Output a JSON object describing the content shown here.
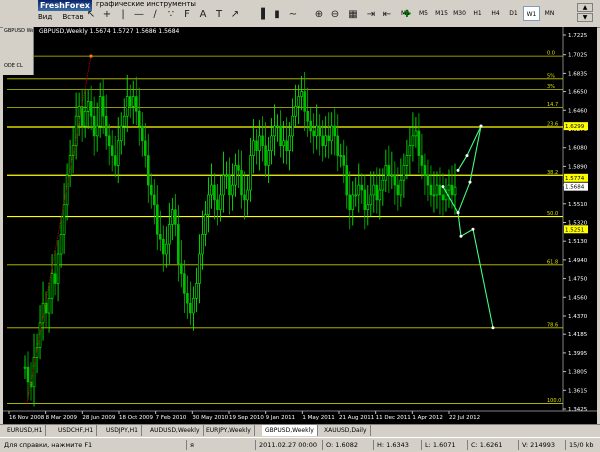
{
  "window": {
    "title": "FreshForex",
    "menu": [
      "Вид",
      "Встав"
    ],
    "toolbar_caption": "графические инструменты"
  },
  "chart_header": {
    "symbol_line": "GBPUSD,Weekly  1.5674 1.5727 1.5686 1.5684",
    "left_stub": "GBPUSD Weekly",
    "left_stub2": "ODE CL"
  },
  "timeframes": [
    "M1",
    "M5",
    "M15",
    "M30",
    "H1",
    "H4",
    "D1",
    "W1",
    "MN"
  ],
  "active_timeframe": "W1",
  "chart_data": {
    "type": "candlestick",
    "symbol": "GBPUSD",
    "timeframe": "Weekly",
    "ylim": [
      1.3425,
      1.7225
    ],
    "y_ticks": [
      "1.7225",
      "1.7025",
      "1.6835",
      "1.6650",
      "1.6460",
      "1.6270",
      "1.6080",
      "1.5890",
      "1.5700",
      "1.5510",
      "1.5320",
      "1.5130",
      "1.4940",
      "1.4750",
      "1.4560",
      "1.4370",
      "1.4185",
      "1.3995",
      "1.3805",
      "1.3615",
      "1.3425"
    ],
    "x_ticks": [
      "16 Nov 2008",
      "8 Mar 2009",
      "28 Jun 2009",
      "18 Oct 2009",
      "7 Feb 2010",
      "30 May 2010",
      "19 Sep 2010",
      "9 Jan 2011",
      "1 May 2011",
      "21 Aug 2011",
      "11 Dec 2011",
      "1 Apr 2012",
      "22 Jul 2012"
    ],
    "fibo_levels": [
      {
        "label": "0.0",
        "price": 1.701
      },
      {
        "label": "5%",
        "price": 1.678
      },
      {
        "label": "3%",
        "price": 1.667
      },
      {
        "label": "14.7",
        "price": 1.649
      },
      {
        "label": "23.6",
        "price": 1.629
      },
      {
        "label": "38.2",
        "price": 1.58
      },
      {
        "label": "50.0",
        "price": 1.538
      },
      {
        "label": "61.8",
        "price": 1.489
      },
      {
        "label": "78.6",
        "price": 1.425
      },
      {
        "label": "100.0",
        "price": 1.348
      }
    ],
    "price_labels": [
      {
        "text": "1.6299",
        "price": 1.6299,
        "bg": "#ffff00"
      },
      {
        "text": "1.5774",
        "price": 1.5774,
        "bg": "#ffff00"
      },
      {
        "text": "1.5684",
        "price": 1.5684,
        "bg": "#ffffff"
      },
      {
        "text": "1.5251",
        "price": 1.5251,
        "bg": "#ffff00"
      }
    ],
    "closes": [
      1.385,
      1.37,
      1.365,
      1.395,
      1.405,
      1.43,
      1.45,
      1.44,
      1.455,
      1.48,
      1.47,
      1.5,
      1.52,
      1.55,
      1.58,
      1.6,
      1.61,
      1.64,
      1.65,
      1.63,
      1.645,
      1.655,
      1.64,
      1.62,
      1.63,
      1.66,
      1.64,
      1.62,
      1.61,
      1.6,
      1.59,
      1.615,
      1.63,
      1.64,
      1.66,
      1.65,
      1.66,
      1.645,
      1.63,
      1.615,
      1.6,
      1.57,
      1.56,
      1.55,
      1.52,
      1.515,
      1.5,
      1.51,
      1.53,
      1.545,
      1.53,
      1.49,
      1.48,
      1.46,
      1.45,
      1.44,
      1.455,
      1.47,
      1.5,
      1.52,
      1.54,
      1.56,
      1.57,
      1.555,
      1.545,
      1.56,
      1.58,
      1.58,
      1.56,
      1.57,
      1.59,
      1.585,
      1.56,
      1.555,
      1.565,
      1.6,
      1.615,
      1.605,
      1.62,
      1.61,
      1.59,
      1.605,
      1.62,
      1.63,
      1.63,
      1.61,
      1.615,
      1.605,
      1.62,
      1.64,
      1.65,
      1.66,
      1.665,
      1.645,
      1.635,
      1.625,
      1.62,
      1.63,
      1.62,
      1.61,
      1.62,
      1.615,
      1.63,
      1.62,
      1.6,
      1.6,
      1.59,
      1.56,
      1.545,
      1.56,
      1.56,
      1.57,
      1.565,
      1.545,
      1.55,
      1.56,
      1.57,
      1.555,
      1.565,
      1.575,
      1.59,
      1.58,
      1.58,
      1.57,
      1.56,
      1.575,
      1.59,
      1.6,
      1.61,
      1.62,
      1.625,
      1.6,
      1.59,
      1.58,
      1.57,
      1.56,
      1.56,
      1.57,
      1.56,
      1.555,
      1.565,
      1.57,
      1.56,
      1.568
    ],
    "forecast_paths": [
      [
        [
          440,
          1.5684
        ],
        [
          455,
          1.542
        ],
        [
          467,
          1.573
        ],
        [
          478,
          1.6299
        ]
      ],
      [
        [
          455,
          1.542
        ],
        [
          458,
          1.518
        ],
        [
          470,
          1.5251
        ],
        [
          490,
          1.425
        ]
      ],
      [
        [
          455,
          1.585
        ],
        [
          464,
          1.6
        ],
        [
          478,
          1.6299
        ]
      ]
    ],
    "colors": {
      "bull": "#00ff00",
      "bear": "#00c000",
      "fibo": "#c8c800",
      "fibo_hl": "#ffff00",
      "bg": "#000000",
      "grid_text": "#ffffff"
    }
  },
  "tabs": [
    "EURUSD,H1",
    "USDCHF,H1",
    "USDJPY,H1",
    "AUDUSD,Weekly",
    "EURJPY,Weekly",
    "GBPUSD,Weekly",
    "XAUUSD,Daily"
  ],
  "active_tab": "GBPUSD,Weekly",
  "status": {
    "help": "Для справки, нажмите F1",
    "profile": "я",
    "datetime": "2011.02.27 00:00",
    "open": "O: 1.6082",
    "high": "H: 1.6343",
    "low": "L: 1.6071",
    "close": "C: 1.6261",
    "volume": "V: 214993",
    "traffic": "15/0 kb"
  }
}
